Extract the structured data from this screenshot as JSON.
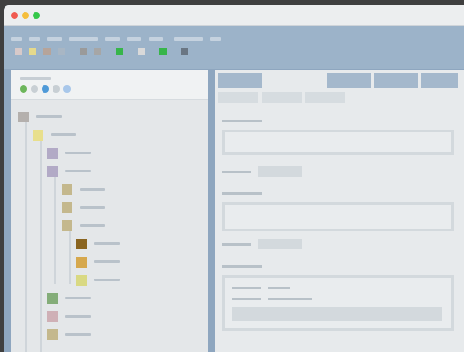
{
  "titlebar": {
    "buttons": [
      {
        "name": "close-button",
        "color": "#f05a50"
      },
      {
        "name": "minimize-button",
        "color": "#f5be3c"
      },
      {
        "name": "maximize-button",
        "color": "#34c749"
      }
    ]
  },
  "toolbar": {
    "menu_items_count": 10,
    "tool_icons": [
      {
        "name": "tool-icon-1",
        "color": "#d7c9c9"
      },
      {
        "name": "tool-icon-2",
        "color": "#e5d98c"
      },
      {
        "name": "tool-icon-3",
        "color": "#b6a49a"
      },
      {
        "name": "tool-icon-4",
        "color": "#a8b6c4"
      },
      {
        "name": "tool-icon-5",
        "color": "#9a9a9a"
      },
      {
        "name": "tool-icon-6",
        "color": "#a6a6a6"
      },
      {
        "name": "tool-icon-7",
        "color": "#37b54a"
      },
      {
        "name": "tool-icon-8",
        "color": "#d9d9d9"
      },
      {
        "name": "tool-icon-9",
        "color": "#37b54a"
      },
      {
        "name": "tool-icon-10",
        "color": "#6a7683"
      }
    ]
  },
  "left_panel": {
    "status_dots": [
      {
        "name": "status-dot-green",
        "color": "#6db65b"
      },
      {
        "name": "status-dot-gray",
        "color": "#c8cfd4"
      },
      {
        "name": "status-dot-blue",
        "color": "#4f9ad8"
      },
      {
        "name": "status-dot-gray-2",
        "color": "#c8cfd4"
      },
      {
        "name": "status-dot-lightblue",
        "color": "#a8c7ea"
      }
    ],
    "tree_nodes": [
      {
        "name": "tree-node-root",
        "color": "#b4b0ad"
      },
      {
        "name": "tree-node-1",
        "color": "#e8df8c"
      },
      {
        "name": "tree-node-2",
        "color": "#b2aac6"
      },
      {
        "name": "tree-node-3",
        "color": "#b2aac6"
      },
      {
        "name": "tree-node-4",
        "color": "#c4b88d"
      },
      {
        "name": "tree-node-5",
        "color": "#c4b88d"
      },
      {
        "name": "tree-node-6",
        "color": "#c4b88d"
      },
      {
        "name": "tree-node-7",
        "color": "#8a6520"
      },
      {
        "name": "tree-node-8",
        "color": "#d6a84d"
      },
      {
        "name": "tree-node-9",
        "color": "#d9d983"
      },
      {
        "name": "tree-node-10",
        "color": "#84ad79"
      },
      {
        "name": "tree-node-11",
        "color": "#cfb0b6"
      },
      {
        "name": "tree-node-12",
        "color": "#c4b88d"
      }
    ]
  },
  "right_panel": {
    "tabs_count": 4,
    "subtabs_count": 3
  }
}
